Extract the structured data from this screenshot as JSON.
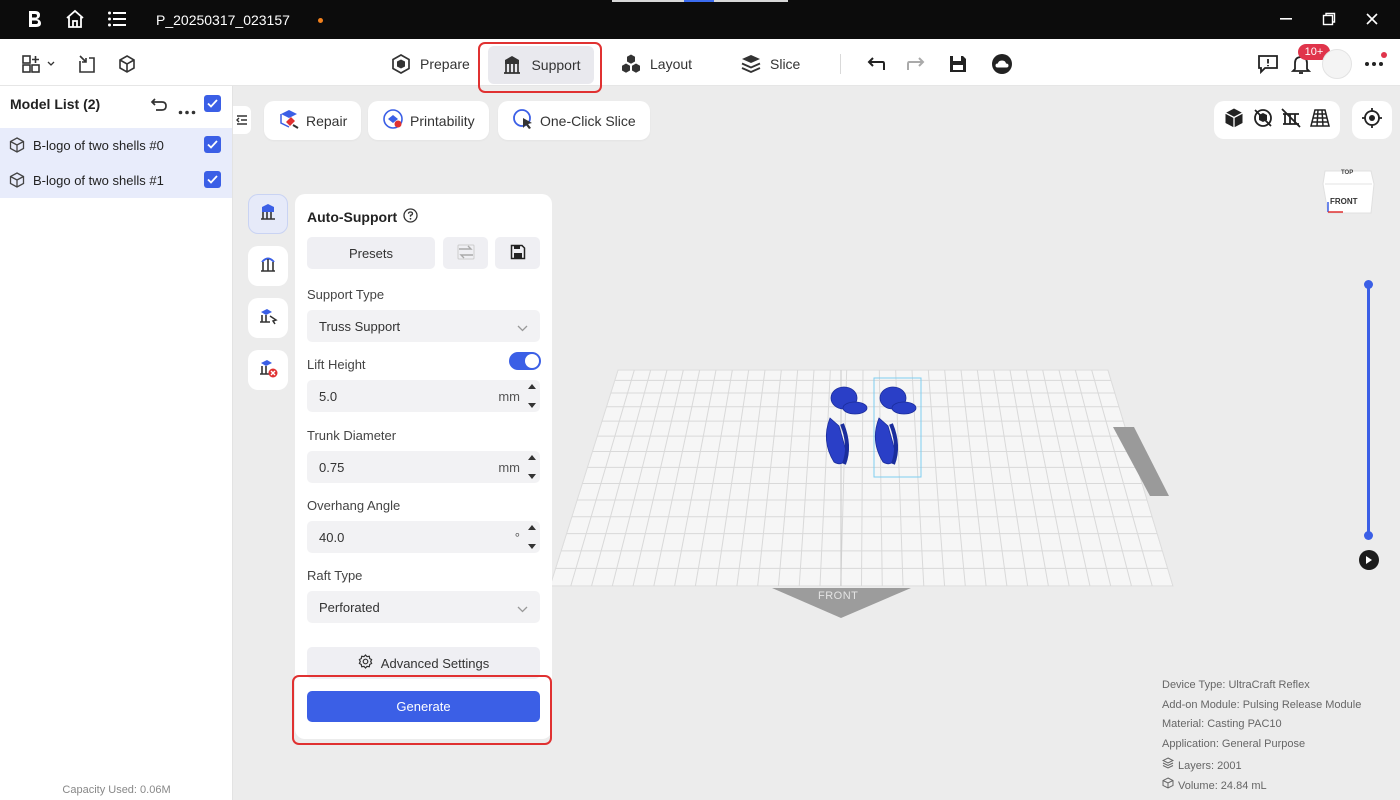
{
  "titlebar": {
    "project_name": "P_20250317_023157"
  },
  "toolbar": {
    "tabs": [
      {
        "label": "Prepare"
      },
      {
        "label": "Support"
      },
      {
        "label": "Layout"
      },
      {
        "label": "Slice"
      }
    ],
    "notification_badge": "10+"
  },
  "sidebar": {
    "title": "Model List (2)",
    "models": [
      {
        "name": "B-logo of two shells #0"
      },
      {
        "name": "B-logo of two shells #1"
      }
    ],
    "capacity": "Capacity Used: 0.06M"
  },
  "viewport_toolbar": {
    "repair": "Repair",
    "printability": "Printability",
    "one_click_slice": "One-Click Slice"
  },
  "auto_support": {
    "title": "Auto-Support",
    "presets_label": "Presets",
    "support_type_label": "Support Type",
    "support_type_value": "Truss Support",
    "lift_height_label": "Lift Height",
    "lift_height_value": "5.0",
    "lift_height_unit": "mm",
    "trunk_diameter_label": "Trunk Diameter",
    "trunk_diameter_value": "0.75",
    "trunk_diameter_unit": "mm",
    "overhang_angle_label": "Overhang Angle",
    "overhang_angle_value": "40.0",
    "overhang_angle_unit": "°",
    "raft_type_label": "Raft Type",
    "raft_type_value": "Perforated",
    "advanced_label": "Advanced Settings",
    "generate_label": "Generate"
  },
  "scene": {
    "front_label": "FRONT",
    "cube_top": "TOP",
    "cube_front": "FRONT"
  },
  "info": {
    "device_type": "Device Type:  UltraCraft Reflex",
    "addon_module": "Add-on Module:  Pulsing Release Module",
    "material": "Material:  Casting PAC10",
    "application": "Application:  General Purpose",
    "layers": "Layers: 2001",
    "volume": "Volume: 24.84 mL"
  },
  "colors": {
    "accent": "#3b5fe6",
    "annotation": "#e03131",
    "model": "#2a3fc7"
  }
}
